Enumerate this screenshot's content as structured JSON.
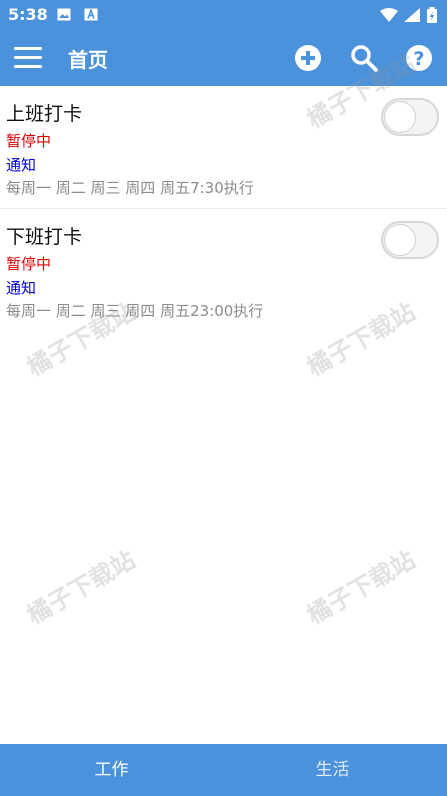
{
  "status_bar": {
    "time": "5:38"
  },
  "app_bar": {
    "title": "首页"
  },
  "tasks": [
    {
      "title": "上班打卡",
      "status": "暂停中",
      "type": "通知",
      "schedule": "每周一 周二 周三 周四 周五7:30执行",
      "enabled": false
    },
    {
      "title": "下班打卡",
      "status": "暂停中",
      "type": "通知",
      "schedule": "每周一 周二 周三 周四 周五23:00执行",
      "enabled": false
    }
  ],
  "tabs": [
    {
      "label": "工作",
      "active": true
    },
    {
      "label": "生活",
      "active": false
    }
  ],
  "watermark": "橘子下载站",
  "colors": {
    "primary": "#4a92dc",
    "status_red": "#e00000",
    "type_blue": "#0000dd",
    "muted": "#8c8c8c"
  }
}
